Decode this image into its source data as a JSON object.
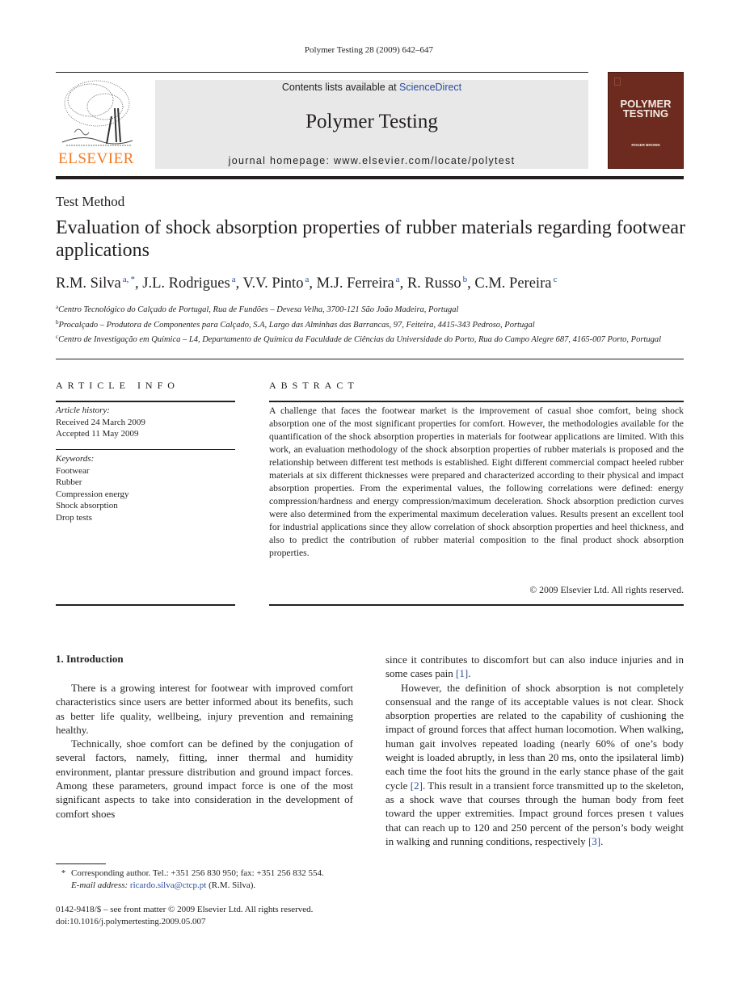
{
  "journal_ref": "Polymer Testing 28 (2009) 642–647",
  "header": {
    "publisher_logo_text": "ELSEVIER",
    "contents_prefix": "Contents lists available at ",
    "contents_link": "ScienceDirect",
    "journal_name": "Polymer Testing",
    "homepage": "journal homepage: www.elsevier.com/locate/polytest",
    "cover_title_line1": "POLYMER",
    "cover_title_line2": "TESTING",
    "cover_editor": "ROGER BROWN",
    "brand_color": "#f47920",
    "cover_color": "#6d2a1e",
    "link_color": "#2a4c9d"
  },
  "article": {
    "type": "Test Method",
    "title": "Evaluation of shock absorption properties of rubber materials regarding footwear applications",
    "authors": [
      {
        "name": "R.M. Silva",
        "sup": "a, *"
      },
      {
        "name": "J.L. Rodrigues",
        "sup": "a"
      },
      {
        "name": "V.V. Pinto",
        "sup": "a"
      },
      {
        "name": "M.J. Ferreira",
        "sup": "a"
      },
      {
        "name": "R. Russo",
        "sup": "b"
      },
      {
        "name": "C.M. Pereira",
        "sup": "c"
      }
    ],
    "affiliations": [
      {
        "key": "a",
        "text": "Centro Tecnológico do Calçado de Portugal, Rua de Fundões – Devesa Velha, 3700-121 São João Madeira, Portugal"
      },
      {
        "key": "b",
        "text": "Procalçado – Produtora de Componentes para Calçado, S.A, Largo das Alminhas das Barrancas, 97, Feiteira, 4415-343 Pedroso, Portugal"
      },
      {
        "key": "c",
        "text": "Centro de Investigação em Química – L4, Departamento de Química da Faculdade de Ciências da Universidade do Porto, Rua do Campo Alegre 687, 4165-007 Porto, Portugal"
      }
    ]
  },
  "article_info": {
    "heading": "ARTICLE INFO",
    "history_label": "Article history:",
    "received": "Received 24 March 2009",
    "accepted": "Accepted 11 May 2009",
    "keywords_label": "Keywords:",
    "keywords": [
      "Footwear",
      "Rubber",
      "Compression energy",
      "Shock absorption",
      "Drop tests"
    ]
  },
  "abstract": {
    "heading": "ABSTRACT",
    "text": "A challenge that faces the footwear market is the improvement of casual shoe comfort, being shock absorption one of the most significant properties for comfort. However, the methodologies available for the quantification of the shock absorption properties in materials for footwear applications are limited. With this work, an evaluation method­ology of the shock absorption properties of rubber materials is proposed and the rela­tionship between different test methods is established. Eight different commercial compact heeled rubber materials at six different thicknesses were prepared and charac­terized according to their physical and impact absorption properties. From the experi­mental values, the following correlations were defined: energy compression/hardness and energy compression/maximum deceleration. Shock absorption prediction curves were also determined from the experimental maximum deceleration values. Results present an excellent tool for industrial applications since they allow correlation of shock absorption properties and heel thickness, and also to predict the contribution of rubber material composition to the final product shock absorption properties.",
    "copyright": "© 2009 Elsevier Ltd. All rights reserved."
  },
  "body": {
    "section_heading": "1.  Introduction",
    "left_paragraphs": [
      "There is a growing interest for footwear with improved comfort characteristics since users are better informed about its benefits, such as better life quality, wellbeing, injury prevention and remaining healthy.",
      "Technically, shoe comfort can be defined by the conju­gation of several factors, namely, fitting, inner thermal and humidity environment, plantar pressure distribution and ground impact forces. Among these parameters, ground impact force is one of the most significant aspects to take into consideration in the development of comfort shoes"
    ],
    "right_p1_text": "since it contributes to discomfort but can also induce injuries and in some cases pain ",
    "right_p1_ref": "[1]",
    "right_p2_a": "However, the definition of shock absorption is not completely consensual and the range of its acceptable values is not clear. Shock absorption properties are related to the capability of cushioning the impact of ground forces that affect human locomotion. When walking, human gait involves repeated loading (nearly 60% of one’s body weight is loaded abruptly, in less than 20 ms, onto the ipsilateral limb) each time the foot hits the ground in the early stance phase of the gait cycle ",
    "right_p2_ref1": "[2]",
    "right_p2_b": ". This result in a transient force transmitted up to the skeleton, as a shock wave that courses through the human body from feet toward the upper extremities. Impact ground forces presen  t values that can reach up to 120 and 250 percent of the person’s body weight in walking and running conditions, respec­tively ",
    "right_p2_ref2": "[3]"
  },
  "footnote": {
    "star": "*",
    "corresponding": "Corresponding author. Tel.: +351 256 830 950; fax: +351 256 832 554.",
    "email_label": "E-mail address:",
    "email": "ricardo.silva@ctcp.pt",
    "email_suffix": " (R.M. Silva)."
  },
  "front_matter": {
    "issn_line": "0142-9418/$ – see front matter © 2009 Elsevier Ltd. All rights reserved.",
    "doi": "doi:10.1016/j.polymertesting.2009.05.007"
  }
}
